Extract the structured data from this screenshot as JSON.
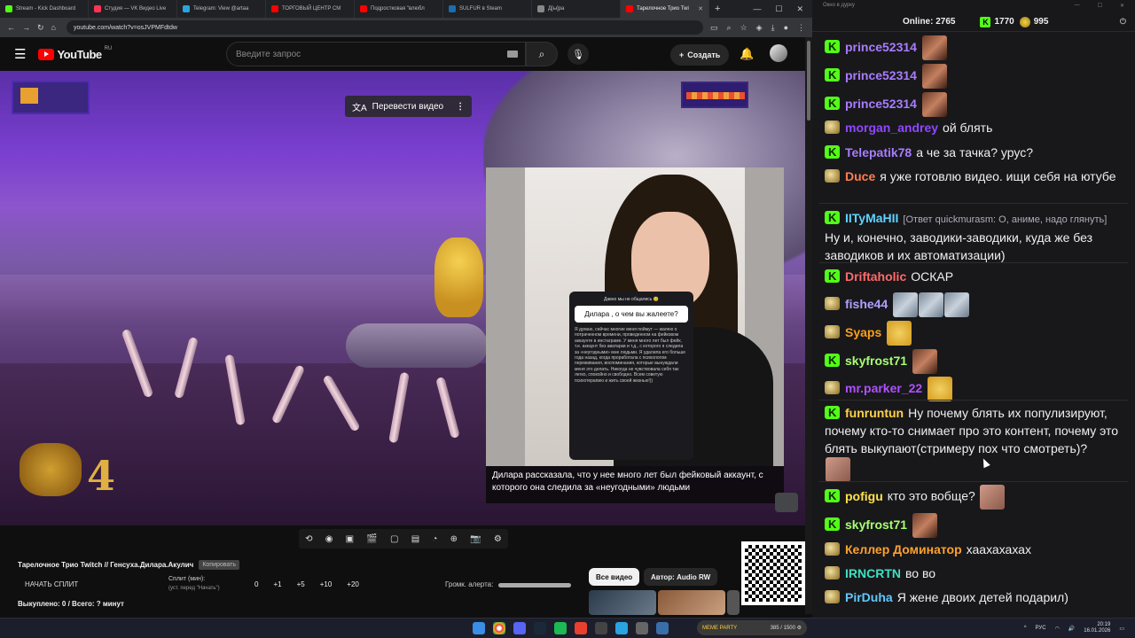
{
  "browser": {
    "tabs": [
      {
        "title": "Stream - Kick Dashboard",
        "color": "#53fc18"
      },
      {
        "title": "Студия — VK Видео Live",
        "color": "#ff3355"
      },
      {
        "title": "Telegram: View @artaa",
        "color": "#2aa3e0"
      },
      {
        "title": "ТОРГОВЫЙ ЦЕНТР СМ",
        "color": "#ff0000"
      },
      {
        "title": "Подростковая \"влюбл",
        "color": "#ff0000"
      },
      {
        "title": "SULFUR в Steam",
        "color": "#1b6db0"
      },
      {
        "title": "Д[ы]ра",
        "color": "#888888"
      },
      {
        "title": "Тарелочное Трио Twi",
        "color": "#ff0000"
      }
    ],
    "url": "youtube.com/watch?v=osJVPMFdtdw"
  },
  "youtube": {
    "logo_text": "YouTube",
    "region": "RU",
    "search_placeholder": "Введите запрос",
    "create_label": "Создать",
    "translate_label": "Перевести видео",
    "subtitle_text": "Дилара рассказала, что у нее много лет был фейковый аккаунт, с которого она следила за «неугодными» людьми",
    "story": {
      "top": "Давно мы не общались 😊",
      "question": "Дилара , о чем вы жалеете?",
      "answer": "Я думаю, сейчас многие меня поймут — жалею о потраченном времени, проведенном на фейковом аккаунте в инстаграме. У меня много лет был фейк, т.е. аккаунт без аватарки и т.д., с которого я следила за «неугодными» мне людьми. Я удалила его больше года назад, когда проработала с психологом переживания, воспоминания, которые вынуждали меня это делать. Никогда не чувствовала себя так легко, спокойно и свободно. Всем советую психотерапию и жить своей жизнью!))"
    },
    "game_lives": "4",
    "video_title": "Тарелочное Трио Twitch // Генсуха.Дилара.Акулич",
    "copy_label": "Копировать",
    "split_button": "НАЧАТЬ СПЛИТ",
    "split_min_label": "Сплит (мин):",
    "split_hint": "(уст. перед \"Начать\")",
    "split_values": [
      "0",
      "+1",
      "+5",
      "+10",
      "+20"
    ],
    "spent_label": "Выкуплено: 0 / Всего: ? минут",
    "alert_label": "Громк. алерта:",
    "chip_all": "Все видео",
    "chip_author": "Автор: Audio RW"
  },
  "taskbar": {
    "now_playing_title": "MEME PARTY",
    "now_playing_progress": "385 / 1500 ⚙",
    "lang": "РУС",
    "time": "20:19",
    "date": "16.01.2026"
  },
  "chat": {
    "window_title": "Окно в дурку",
    "online_label": "Online:",
    "online_count": "2765",
    "count_kick": "1770",
    "count_trophy": "995",
    "messages": [
      {
        "user": "prince52314",
        "color": "#a87cff",
        "text": "",
        "badge": "kick"
      },
      {
        "user": "prince52314",
        "color": "#a87cff",
        "text": "",
        "badge": "kick"
      },
      {
        "user": "prince52314",
        "color": "#a87cff",
        "text": "",
        "badge": "kick"
      },
      {
        "user": "morgan_andrey",
        "color": "#9146ff",
        "text": "ой блять",
        "badge": "other"
      },
      {
        "user": "Telepatik78",
        "color": "#a87cff",
        "text": "а че за тачка? урус?",
        "badge": "kick"
      },
      {
        "user": "Duce",
        "color": "#ff7f50",
        "text": "я уже готовлю видео. ищи себя на ютубе",
        "badge": "other"
      },
      {
        "user": "IITyMaHII",
        "color": "#5fd3ff",
        "reply": "[Ответ quickmurasm: О, аниме, надо глянуть]",
        "text": "Ну и, конечно, заводики-заводики, куда же без заводиков и их автоматизации)",
        "badge": "kick"
      },
      {
        "user": "Driftaholic",
        "color": "#ff6b6b",
        "text": "ОСКАР",
        "badge": "kick"
      },
      {
        "user": "fishe44",
        "color": "#b0a0ff",
        "text": "",
        "badge": "other"
      },
      {
        "user": "Syaps",
        "color": "#ff9f1a",
        "text": "",
        "badge": "other"
      },
      {
        "user": "skyfrost71",
        "color": "#a8ff70",
        "text": "",
        "badge": "kick"
      },
      {
        "user": "mr.parker_22",
        "color": "#b050ff",
        "text": "",
        "badge": "other"
      },
      {
        "user": "funruntun",
        "color": "#ffd24a",
        "text": "Ну почему блять их популизируют, почему кто-то снимает про это контент, почему это блять выкупают(стримеру пох что смотреть)?",
        "badge": "kick"
      },
      {
        "user": "pofigu",
        "color": "#ffe14a",
        "text": "кто это вобще?",
        "badge": "kick"
      },
      {
        "user": "skyfrost71",
        "color": "#a8ff70",
        "text": "",
        "badge": "kick"
      },
      {
        "user": "Келлер Доминатор",
        "color": "#ffa12b",
        "text": "хаахахахах",
        "badge": "other"
      },
      {
        "user": "IRNCRTN",
        "color": "#3fe0c0",
        "text": "во во",
        "badge": "other"
      },
      {
        "user": "PirDuha",
        "color": "#60c8ff",
        "text": "Я жене двоих детей подарил)",
        "badge": "other"
      }
    ]
  },
  "colors": {
    "accent_red": "#ff0000",
    "kick_green": "#53fc18",
    "chat_bg": "#18181b"
  }
}
